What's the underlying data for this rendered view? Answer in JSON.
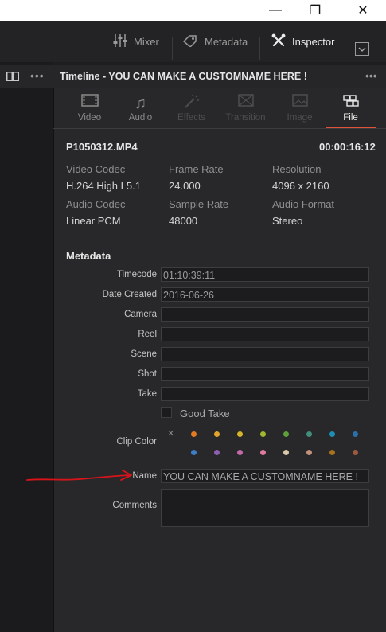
{
  "window": {
    "minimize": "—",
    "maximize": "❐",
    "close": "✕"
  },
  "toolbar": {
    "mixer": "Mixer",
    "metadata": "Metadata",
    "inspector": "Inspector"
  },
  "timeline_title": "Timeline - YOU CAN MAKE A CUSTOMNAME HERE !",
  "tabs": [
    {
      "label": "Video",
      "icon": "film-icon"
    },
    {
      "label": "Audio",
      "icon": "music-note-icon"
    },
    {
      "label": "Effects",
      "icon": "magic-wand-icon"
    },
    {
      "label": "Transition",
      "icon": "transition-icon"
    },
    {
      "label": "Image",
      "icon": "image-icon"
    },
    {
      "label": "File",
      "icon": "file-cubes-icon"
    }
  ],
  "file": {
    "name": "P1050312.MP4",
    "duration": "00:00:16:12",
    "props": [
      {
        "label": "Video Codec",
        "value": "H.264 High L5.1"
      },
      {
        "label": "Frame Rate",
        "value": "24.000"
      },
      {
        "label": "Resolution",
        "value": "4096 x 2160"
      },
      {
        "label": "Audio Codec",
        "value": "Linear PCM"
      },
      {
        "label": "Sample Rate",
        "value": "48000"
      },
      {
        "label": "Audio Format",
        "value": "Stereo"
      }
    ]
  },
  "metadata": {
    "heading": "Metadata",
    "fields": [
      {
        "label": "Timecode",
        "value": "01:10:39:11"
      },
      {
        "label": "Date Created",
        "value": "2016-06-26"
      },
      {
        "label": "Camera",
        "value": ""
      },
      {
        "label": "Reel",
        "value": ""
      },
      {
        "label": "Scene",
        "value": ""
      },
      {
        "label": "Shot",
        "value": ""
      },
      {
        "label": "Take",
        "value": ""
      }
    ],
    "good_take": "Good Take",
    "clip_color": "Clip Color",
    "clip_colors_row1": [
      "#e07b22",
      "#e0a52a",
      "#d6b52a",
      "#9fb82e",
      "#5f9f3a",
      "#3f8f7a",
      "#1d8fb5",
      "#2a6fa8"
    ],
    "clip_colors_row2": [
      "#3c7fc7",
      "#8d5fb0",
      "#c46aa8",
      "#e07aa0",
      "#d8c8a8",
      "#c0927a",
      "#a8711f",
      "#9a5a3f"
    ],
    "name_label": "Name",
    "name_value": "YOU CAN MAKE A CUSTOMNAME HERE !",
    "comments_label": "Comments",
    "comments_value": ""
  },
  "annotation_color": "#d8141a"
}
